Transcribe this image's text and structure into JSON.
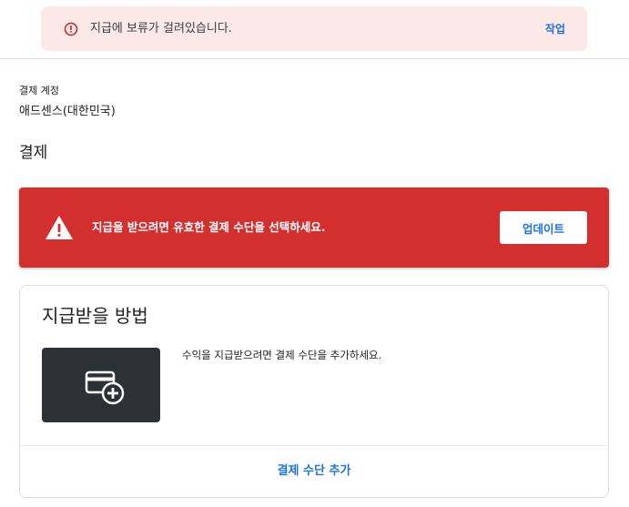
{
  "top_alert": {
    "icon": "error-outline-icon",
    "message": "지급에 보류가 걸려있습니다.",
    "action_label": "작업"
  },
  "account": {
    "label": "결제 계정",
    "value": "애드센스(대한민국)"
  },
  "section": {
    "title": "결제"
  },
  "warning_banner": {
    "icon": "warning-icon",
    "message": "지급을 받으려면 유효한 결제 수단을 선택하세요.",
    "button_label": "업데이트",
    "color": "#d32f2f"
  },
  "payment_card": {
    "title": "지급받을 방법",
    "tile_icon": "add-payment-card-icon",
    "hint": "수익을 지급받으려면 결제 수단을 추가하세요.",
    "add_link": "결제 수단 추가"
  },
  "colors": {
    "accent": "#1a73e8",
    "alert_bg": "#fce8e6",
    "alert_icon": "#c5221f"
  }
}
